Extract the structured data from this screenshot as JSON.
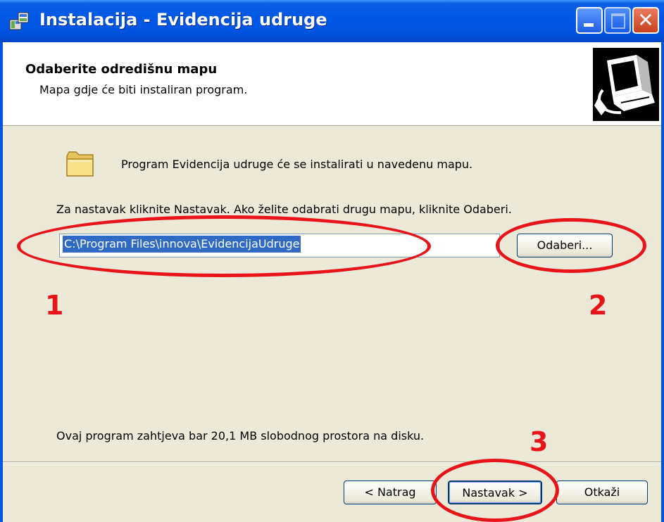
{
  "window": {
    "title": "Instalacija - Evidencija udruge",
    "controls": {
      "close_glyph": "✕"
    }
  },
  "header": {
    "title": "Odaberite odredišnu mapu",
    "subtitle": "Mapa gdje će biti instaliran program."
  },
  "body": {
    "install_text": "Program Evidencija udruge će se instalirati u navedenu mapu.",
    "instruction_text": "Za nastavak kliknite Nastavak. Ako želite odabrati drugu mapu, kliknite Odaberi.",
    "path_value": "C:\\Program Files\\innova\\EvidencijaUdruge",
    "browse_label": "Odaberi...",
    "disk_space_text": "Ovaj program zahtjeva bar 20,1 MB slobodnog prostora na disku."
  },
  "footer": {
    "back_label": "< Natrag",
    "next_label": "Nastavak >",
    "cancel_label": "Otkaži"
  },
  "annotations": {
    "label_1": "1",
    "label_2": "2",
    "label_3": "3",
    "color": "#e8141a"
  },
  "colors": {
    "titlebar": "#0055e5",
    "dialog_bg": "#ece9d8",
    "selection": "#316ac5"
  }
}
